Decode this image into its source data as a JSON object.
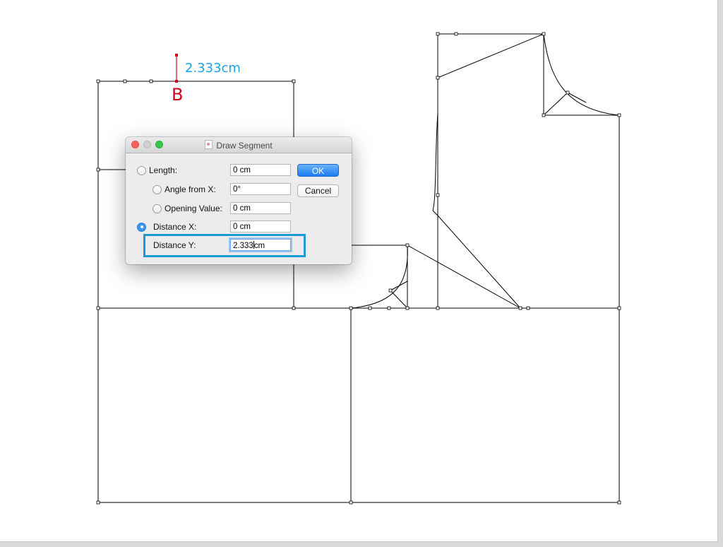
{
  "annotation": {
    "measurement": "2.333cm",
    "point_label": "B"
  },
  "dialog": {
    "title": "Draw Segment",
    "options": {
      "length": {
        "label": "Length:",
        "value": "0 cm",
        "selected": false
      },
      "angle": {
        "label": "Angle from X:",
        "value": "0°",
        "selected": false
      },
      "opening": {
        "label": "Opening Value:",
        "value": "0 cm",
        "selected": false
      },
      "distance_x": {
        "label": "Distance X:",
        "value": "0 cm",
        "selected": true
      },
      "distance_y": {
        "label": "Distance Y:",
        "value_before_caret": "2.333",
        "value_after_caret": "cm"
      }
    },
    "ok_label": "OK",
    "cancel_label": "Cancel"
  },
  "colors": {
    "measurement": "#1aa3e8",
    "point": "#d0021b",
    "highlight": "#1b9bd8",
    "ok_button": "#1a7df2"
  }
}
